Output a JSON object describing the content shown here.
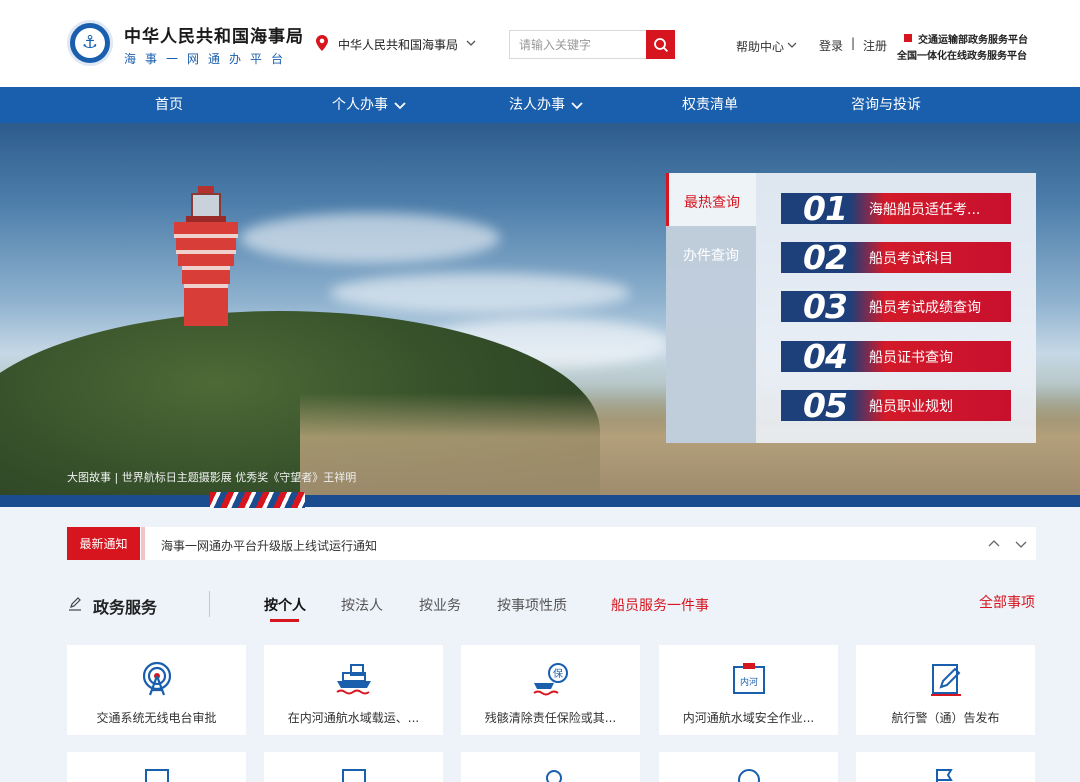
{
  "header": {
    "brand_title": "中华人民共和国海事局",
    "brand_subtitle": "海事一网通办平台",
    "location": "中华人民共和国海事局",
    "search_placeholder": "请输入关键字",
    "help": "帮助中心",
    "login": "登录",
    "separator": "|",
    "register": "注册",
    "gov_line1": "交通运输部政务服务平台",
    "gov_line2": "全国一体化在线政务服务平台"
  },
  "nav": {
    "items": [
      {
        "label": "首页"
      },
      {
        "label": "个人办事"
      },
      {
        "label": "法人办事"
      },
      {
        "label": "权责清单"
      },
      {
        "label": "咨询与投诉"
      }
    ]
  },
  "hero": {
    "caption": "大图故事 | 世界航标日主题摄影展 优秀奖《守望者》王祥明"
  },
  "query_panel": {
    "tabs": [
      "最热查询",
      "办件查询"
    ],
    "items": [
      {
        "num": "01",
        "label": "海船船员适任考..."
      },
      {
        "num": "02",
        "label": "船员考试科目"
      },
      {
        "num": "03",
        "label": "船员考试成绩查询"
      },
      {
        "num": "04",
        "label": "船员证书查询"
      },
      {
        "num": "05",
        "label": "船员职业规划"
      }
    ]
  },
  "notice": {
    "tag": "最新通知",
    "text": "海事一网通办平台升级版上线试运行通知"
  },
  "services": {
    "title": "政务服务",
    "tabs": [
      "按个人",
      "按法人",
      "按业务",
      "按事项性质"
    ],
    "special_tab": "船员服务一件事",
    "all": "全部事项",
    "cards": [
      {
        "label": "交通系统无线电台审批",
        "icon": "radio-tower-icon"
      },
      {
        "label": "在内河通航水域载运、...",
        "icon": "cargo-ship-icon"
      },
      {
        "label": "残骸清除责任保险或其...",
        "icon": "insurance-ship-icon"
      },
      {
        "label": "内河通航水域安全作业...",
        "icon": "inland-river-icon"
      },
      {
        "label": "航行警（通）告发布",
        "icon": "notice-edit-icon"
      }
    ]
  },
  "colors": {
    "brand_blue": "#1a5fae",
    "accent_red": "#d7151e"
  }
}
